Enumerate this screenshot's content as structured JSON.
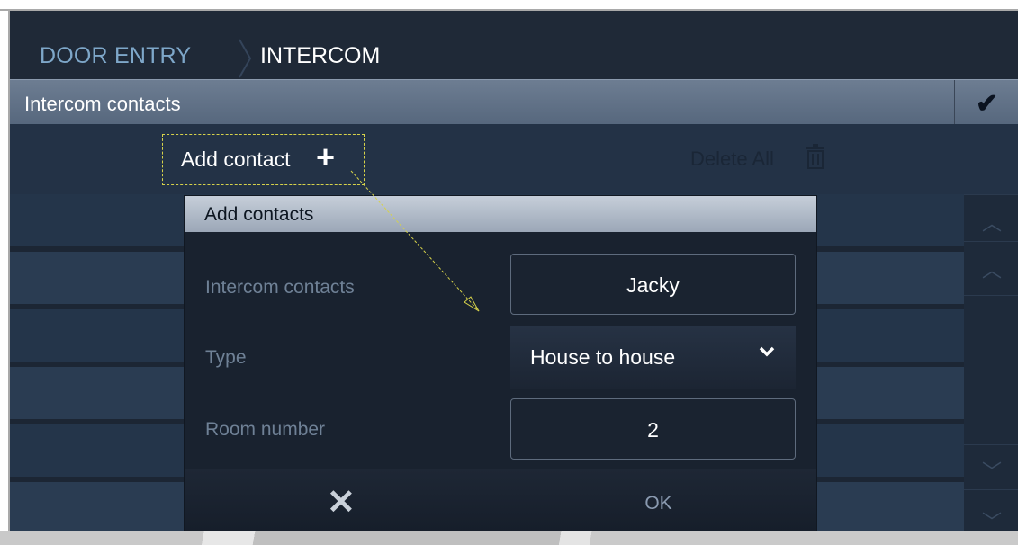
{
  "breadcrumb": {
    "level1": "DOOR ENTRY",
    "level2": "INTERCOM"
  },
  "list_header": {
    "title": "Intercom contacts",
    "confirm_icon": "checkmark-icon"
  },
  "actions": {
    "add_label": "Add contact",
    "add_icon": "plus-icon",
    "delete_label": "Delete All",
    "delete_icon": "trash-icon"
  },
  "dialog": {
    "title": "Add contacts",
    "fields": [
      {
        "label": "Intercom contacts",
        "value": "Jacky"
      },
      {
        "label": "Type",
        "value": "House to house"
      },
      {
        "label": "Room number",
        "value": "2"
      }
    ],
    "cancel_icon": "close-icon",
    "ok_label": "OK"
  },
  "colors": {
    "screen_bg": "#1c2634",
    "header_bar": "#6d7d92",
    "dialog_header": "#c6ced9",
    "highlight_dash": "#d6d24a"
  }
}
